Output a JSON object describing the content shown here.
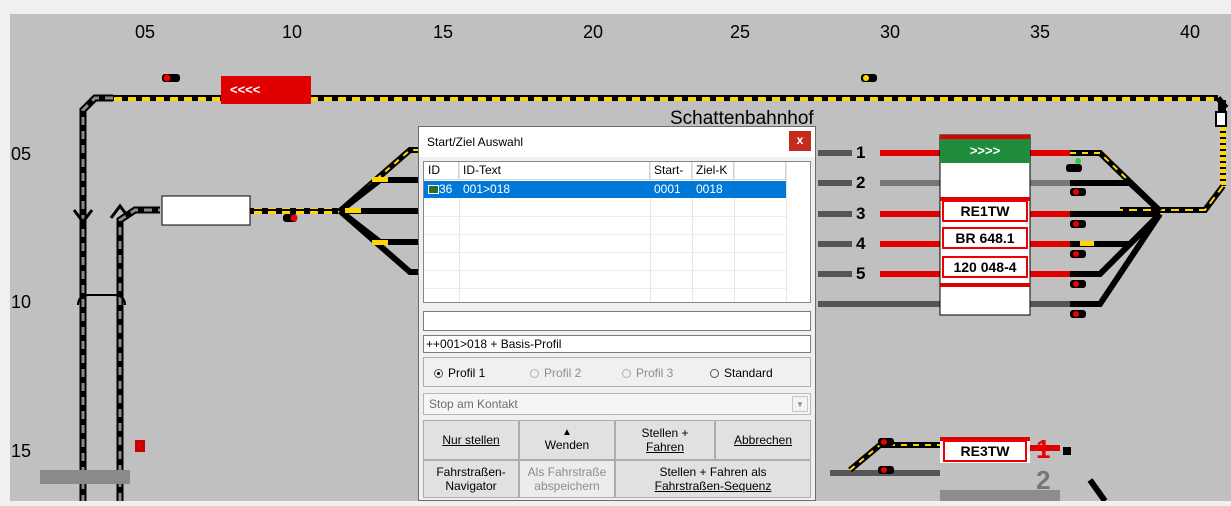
{
  "board": {
    "columns": [
      "05",
      "10",
      "15",
      "20",
      "25",
      "30",
      "35",
      "40"
    ],
    "rows": [
      "05",
      "10",
      "15"
    ],
    "shadow_station_label": "Schattenbahnhof",
    "track_numbers": [
      "1",
      "2",
      "3",
      "4",
      "5"
    ],
    "lower_track_numbers": [
      "1",
      "2"
    ],
    "trains": {
      "top_red": "<<<<",
      "green": ">>>>",
      "t3": "RE1TW",
      "t4": "BR 648.1",
      "t5": "120 048-4",
      "lower": "RE3TW"
    }
  },
  "dialog": {
    "title": "Start/Ziel Auswahl",
    "close_label": "x",
    "columns": [
      "ID",
      "ID-Text",
      "Start-K",
      "Ziel-K"
    ],
    "rows": [
      {
        "id": "36",
        "text": "001>018",
        "start": "0001",
        "ziel": "0018"
      }
    ],
    "search_value": "",
    "info_text": "++001>018 + Basis-Profil",
    "profiles": [
      {
        "label": "Profil 1",
        "selected": true,
        "enabled": true
      },
      {
        "label": "Profil 2",
        "selected": false,
        "enabled": false
      },
      {
        "label": "Profil 3",
        "selected": false,
        "enabled": false
      },
      {
        "label": "Standard",
        "selected": false,
        "enabled": true
      }
    ],
    "stop_select": "Stop am Kontakt",
    "buttons": {
      "nur_stellen": "Nur stellen",
      "wenden": "Wenden",
      "stellen_fahren_1": "Stellen +",
      "stellen_fahren_2": "Fahren",
      "abbrechen": "Abbrechen",
      "navigator_1": "Fahrstraßen-",
      "navigator_2": "Navigator",
      "speichern_1": "Als Fahrstraße",
      "speichern_2": "abspeichern",
      "sequenz_1": "Stellen + Fahren als",
      "sequenz_2": "Fahrstraßen-Sequenz"
    }
  },
  "colors": {
    "board_bg": "#c0c0c0",
    "track_yellow": "#ffd700",
    "track_red": "#e00000",
    "selection_blue": "#0078d7",
    "train_green": "#1e8c3a"
  }
}
